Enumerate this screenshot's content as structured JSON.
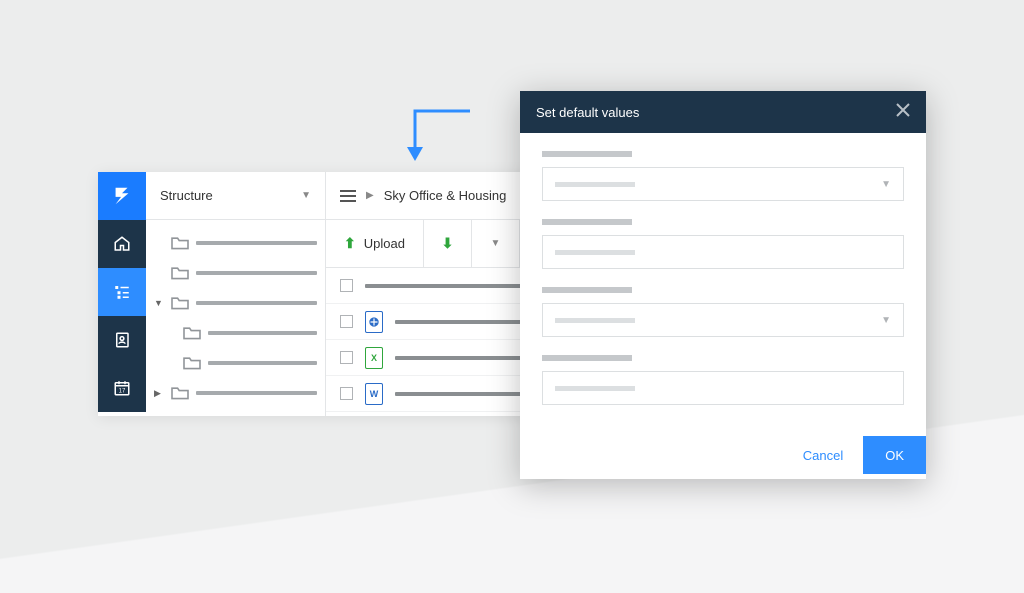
{
  "sidebar": {
    "structure_label": "Structure"
  },
  "breadcrumb": {
    "path": "Sky Office & Housing"
  },
  "toolbar": {
    "upload_label": "Upload"
  },
  "dialog": {
    "title": "Set default values",
    "cancel_label": "Cancel",
    "ok_label": "OK"
  }
}
